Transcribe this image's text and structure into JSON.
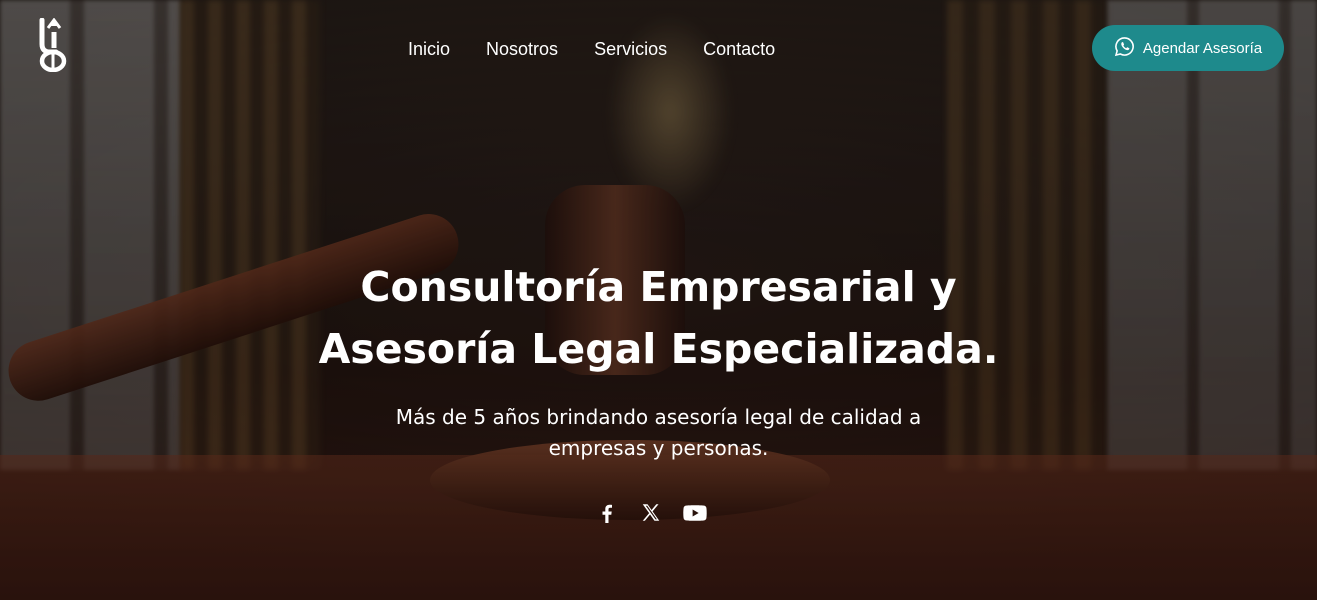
{
  "header": {
    "logo_icon": "law-firm-logo-icon",
    "nav": [
      {
        "label": "Inicio"
      },
      {
        "label": "Nosotros"
      },
      {
        "label": "Servicios"
      },
      {
        "label": "Contacto"
      }
    ],
    "cta": {
      "label": "Agendar Asesoría",
      "icon": "whatsapp-icon",
      "color": "#1e8a8c"
    }
  },
  "hero": {
    "headline_line1": "Consultoría Empresarial y",
    "headline_line2": "Asesoría Legal Especializada.",
    "subtitle_line1": "Más de 5 años brindando asesoría legal de calidad a",
    "subtitle_line2": "empresas y personas.",
    "background": "gavel-courtroom-photo"
  },
  "social": [
    {
      "icon": "facebook-icon"
    },
    {
      "icon": "x-icon"
    },
    {
      "icon": "youtube-icon"
    }
  ]
}
